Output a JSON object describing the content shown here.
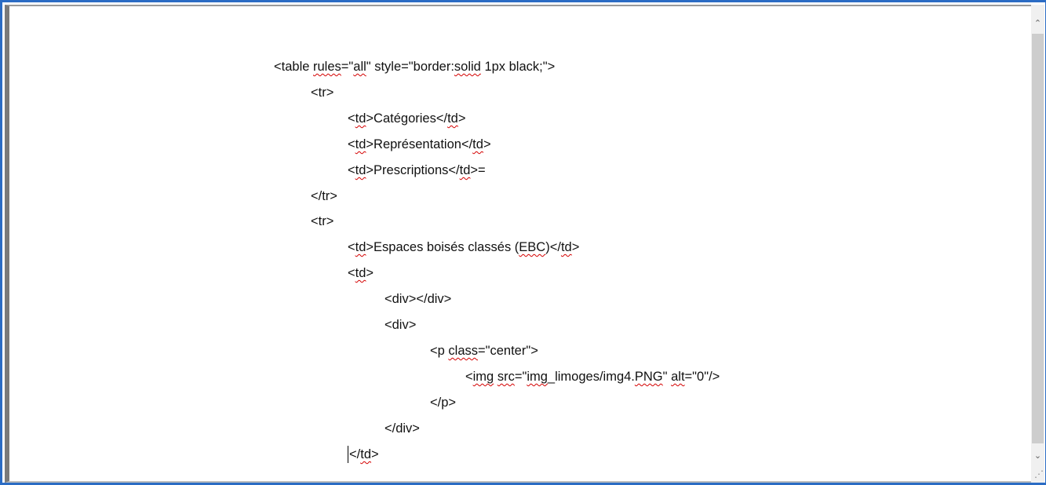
{
  "editor": {
    "lines": [
      {
        "indent": 0,
        "parts": [
          {
            "t": "<table "
          },
          {
            "t": "rules",
            "sq": true
          },
          {
            "t": "=\""
          },
          {
            "t": "all",
            "sq": true
          },
          {
            "t": "\" style=\"border:"
          },
          {
            "t": "solid",
            "sq": true
          },
          {
            "t": " 1px black;\">"
          }
        ]
      },
      {
        "indent": 1,
        "parts": [
          {
            "t": "<tr>"
          }
        ]
      },
      {
        "indent": 2,
        "parts": [
          {
            "t": "<"
          },
          {
            "t": "td",
            "sq": true
          },
          {
            "t": ">Catégories</"
          },
          {
            "t": "td",
            "sq": true
          },
          {
            "t": ">"
          }
        ]
      },
      {
        "indent": 2,
        "parts": [
          {
            "t": "<"
          },
          {
            "t": "td",
            "sq": true
          },
          {
            "t": ">Représentation</"
          },
          {
            "t": "td",
            "sq": true
          },
          {
            "t": ">"
          }
        ]
      },
      {
        "indent": 2,
        "parts": [
          {
            "t": "<"
          },
          {
            "t": "td",
            "sq": true
          },
          {
            "t": ">Prescriptions</"
          },
          {
            "t": "td",
            "sq": true
          },
          {
            "t": ">="
          }
        ]
      },
      {
        "indent": 1,
        "parts": [
          {
            "t": "</tr>"
          }
        ]
      },
      {
        "indent": 1,
        "parts": [
          {
            "t": "<tr>"
          }
        ]
      },
      {
        "indent": 2,
        "parts": [
          {
            "t": "<"
          },
          {
            "t": "td",
            "sq": true
          },
          {
            "t": ">Espaces boisés classés ("
          },
          {
            "t": "EBC",
            "sq": true
          },
          {
            "t": ")</"
          },
          {
            "t": "td",
            "sq": true
          },
          {
            "t": ">"
          }
        ]
      },
      {
        "indent": 2,
        "parts": [
          {
            "t": "<"
          },
          {
            "t": "td",
            "sq": true
          },
          {
            "t": ">"
          }
        ]
      },
      {
        "indent": 3,
        "parts": [
          {
            "t": "<div></div>"
          }
        ]
      },
      {
        "indent": 3,
        "parts": [
          {
            "t": "<div>"
          }
        ]
      },
      {
        "indent": 4,
        "parts": [
          {
            "t": "<p "
          },
          {
            "t": "class",
            "sq": true
          },
          {
            "t": "=\"center\">"
          }
        ]
      },
      {
        "indent": 5,
        "parts": [
          {
            "t": "<"
          },
          {
            "t": "img",
            "sq": true
          },
          {
            "t": " "
          },
          {
            "t": "src",
            "sq": true
          },
          {
            "t": "=\""
          },
          {
            "t": "img",
            "sq": true
          },
          {
            "t": "_limoges/img4."
          },
          {
            "t": "PNG",
            "sq": true
          },
          {
            "t": "\" "
          },
          {
            "t": "alt",
            "sq": true
          },
          {
            "t": "=\"0\"/>"
          }
        ]
      },
      {
        "indent": 4,
        "parts": [
          {
            "t": "</p>"
          }
        ]
      },
      {
        "indent": 3,
        "parts": [
          {
            "t": "</div>"
          }
        ]
      },
      {
        "indent": 2,
        "caret": true,
        "parts": [
          {
            "t": "</"
          },
          {
            "t": "td",
            "sq": true
          },
          {
            "t": ">"
          }
        ]
      }
    ]
  },
  "scrollbar": {
    "up_icon": "chevron-up-icon",
    "up_glyph": "⌃",
    "down_icon": "chevron-down-icon",
    "down_glyph": "⌄"
  },
  "resize_grip": {
    "icon": "resize-grip-icon",
    "glyph": "⋰"
  },
  "colors": {
    "frame_border": "#2b6cc4",
    "spellcheck_underline": "#d40000",
    "text": "#111111"
  }
}
